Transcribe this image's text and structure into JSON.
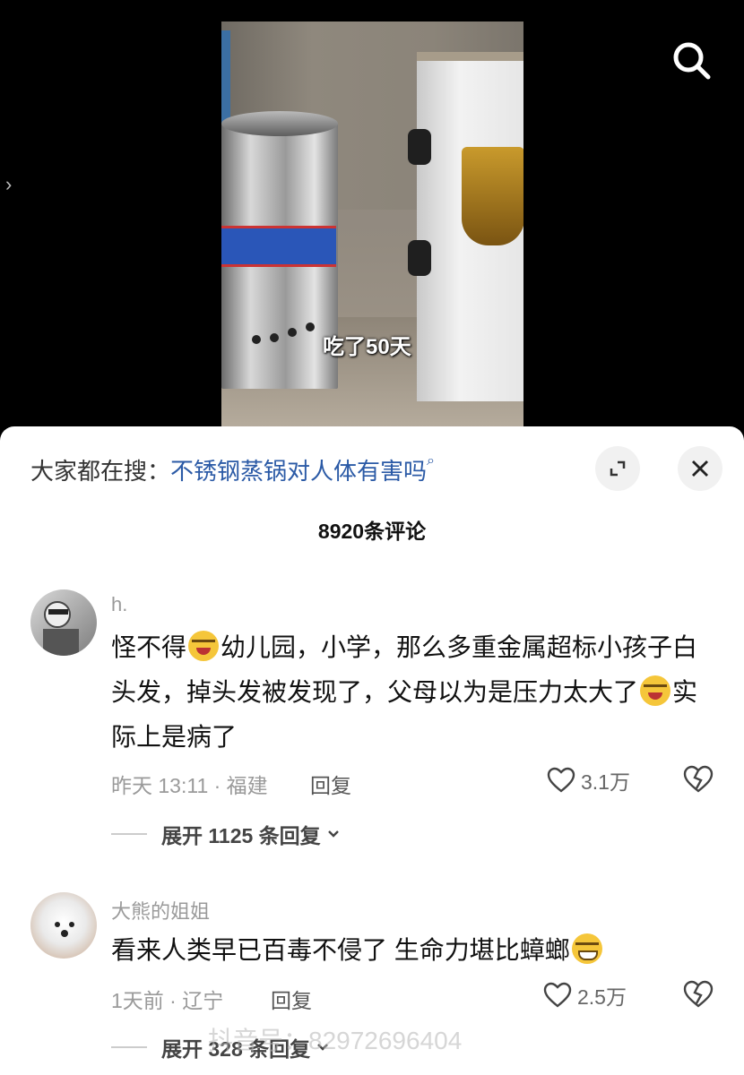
{
  "video": {
    "caption": "吃了50天"
  },
  "hot_search": {
    "prefix": "大家都在搜：",
    "query": "不锈钢蒸锅对人体有害吗"
  },
  "comments_count": "8920条评论",
  "comments": [
    {
      "username": "h.",
      "text_part1": "怪不得",
      "text_part2": "幼儿园，小学，那么多重金属超标小孩子白头发，掉头发被发现了，父母以为是压力太大了",
      "text_part3": "实际上是病了",
      "emoji": "crying-laughing",
      "time_location": "昨天 13:11 · 福建",
      "reply_label": "回复",
      "likes": "3.1万",
      "expand_label": "展开 1125 条回复"
    },
    {
      "username": "大熊的姐姐",
      "text_part1": "看来人类早已百毒不侵了 生命力堪比蟑螂",
      "emoji": "grin-sweat",
      "time_location": "1天前 · 辽宁",
      "reply_label": "回复",
      "likes": "2.5万",
      "expand_label": "展开 328 条回复"
    }
  ],
  "watermark": "抖音号：82972696404"
}
